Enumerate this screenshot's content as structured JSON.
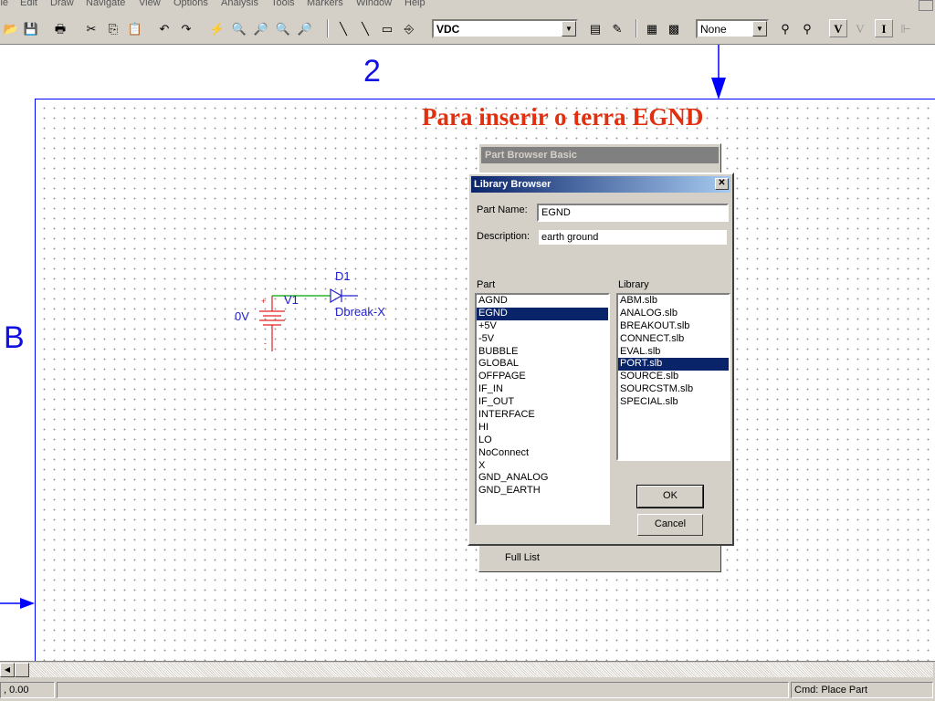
{
  "menu": {
    "items": [
      "ile",
      "Edit",
      "Draw",
      "Navigate",
      "View",
      "Options",
      "Analysis",
      "Tools",
      "Markers",
      "Window",
      "Help"
    ]
  },
  "toolbar": {
    "analysis_combo": "VDC",
    "marker_combo": "None",
    "voltage_marker": "V",
    "current_marker": "I"
  },
  "canvas": {
    "zone_column": "2",
    "zone_row": "B",
    "caption": "Para inserir o terra EGND",
    "caption_color": "#e03010",
    "schematic": {
      "source_value": "0V",
      "source_name": "V1",
      "diode_name": "D1",
      "diode_model": "Dbreak-X",
      "plus_sign": "+",
      "minus_sign": "-"
    }
  },
  "part_browser": {
    "title": "Part Browser Basic",
    "full_list_label": "Full List"
  },
  "library_browser": {
    "title": "Library Browser",
    "close_glyph": "✕",
    "part_name_label": "Part Name:",
    "part_name_value": "EGND",
    "description_label": "Description:",
    "description_value": "earth ground",
    "part_header": "Part",
    "library_header": "Library",
    "parts": [
      "AGND",
      "EGND",
      "+5V",
      "-5V",
      "BUBBLE",
      "GLOBAL",
      "OFFPAGE",
      "IF_IN",
      "IF_OUT",
      "INTERFACE",
      "HI",
      "LO",
      "NoConnect",
      "X",
      "GND_ANALOG",
      "GND_EARTH"
    ],
    "selected_part": "EGND",
    "libraries": [
      "ABM.slb",
      "ANALOG.slb",
      "BREAKOUT.slb",
      "CONNECT.slb",
      "EVAL.slb",
      "PORT.slb",
      "SOURCE.slb",
      "SOURCSTM.slb",
      "SPECIAL.slb"
    ],
    "selected_library": "PORT.slb",
    "ok_label": "OK",
    "cancel_label": "Cancel"
  },
  "statusbar": {
    "coords": ", 0.00",
    "command": "Cmd: Place Part"
  },
  "colors": {
    "window_face": "#d4d0c8",
    "sheet_border": "#0000ff",
    "selection": "#0a246a",
    "schematic_red": "#e02020",
    "schematic_green": "#00a000",
    "schematic_blue": "#2020d0"
  }
}
